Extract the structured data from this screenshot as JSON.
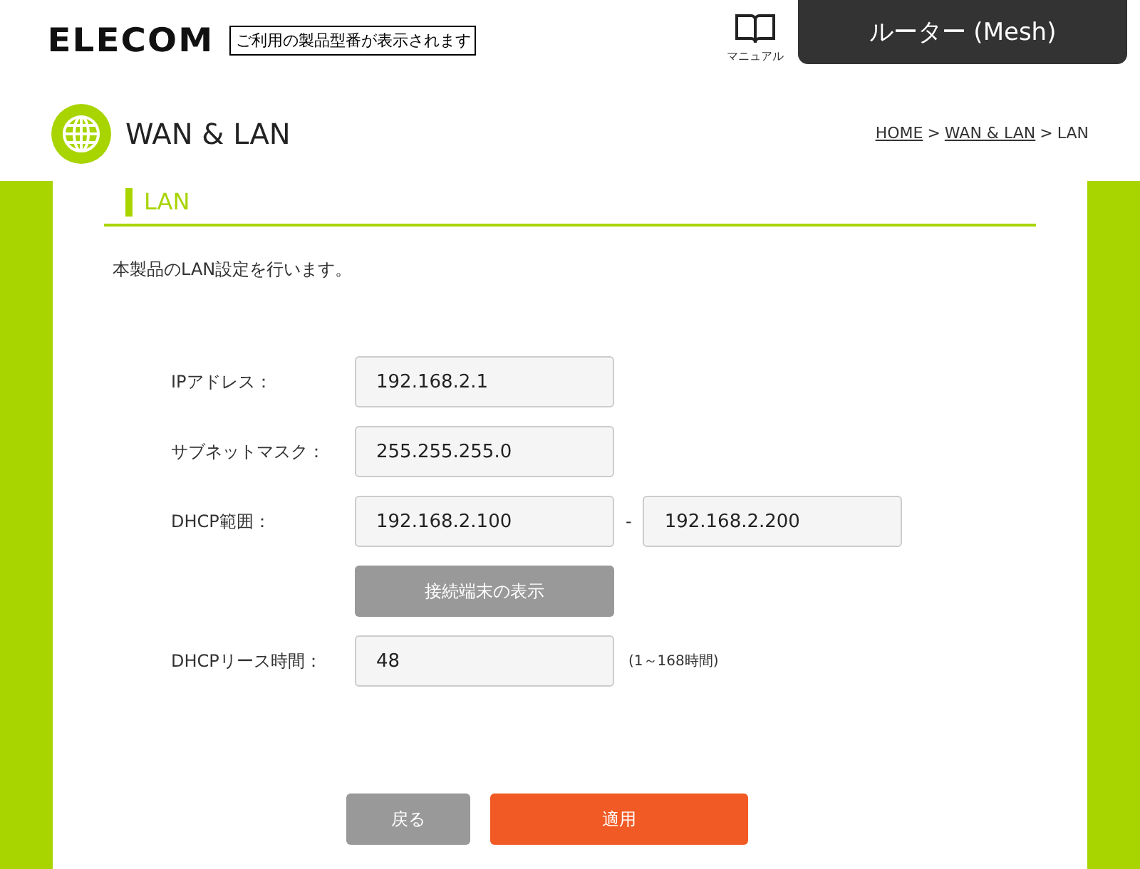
{
  "header": {
    "logo": "ELECOM",
    "model_label": "ご利用の製品型番が表示されます",
    "manual_label": "マニュアル",
    "mode_tab": "ルーター (Mesh)"
  },
  "page_title": "WAN & LAN",
  "breadcrumb": {
    "separator": ">",
    "items": [
      {
        "label": "HOME",
        "link": true
      },
      {
        "label": "WAN & LAN",
        "link": true
      },
      {
        "label": "LAN",
        "link": false
      }
    ]
  },
  "section": {
    "title": "LAN",
    "description": "本製品のLAN設定を行います。"
  },
  "form_rows": [
    {
      "kind": "input",
      "label": "IPアドレス：",
      "value": "192.168.2.1"
    },
    {
      "kind": "input",
      "label": "サブネットマスク：",
      "value": "255.255.255.0"
    },
    {
      "kind": "range",
      "label": "DHCP範囲：",
      "from": "192.168.2.100",
      "separator": "-",
      "to": "192.168.2.200"
    },
    {
      "kind": "button",
      "label": "接続端末の表示"
    },
    {
      "kind": "input",
      "label": "DHCPリース時間：",
      "value": "48",
      "hint": "(1～168時間)"
    }
  ],
  "buttons": [
    {
      "label": "戻る",
      "kind": "secondary"
    },
    {
      "label": "適用",
      "kind": "primary"
    }
  ]
}
